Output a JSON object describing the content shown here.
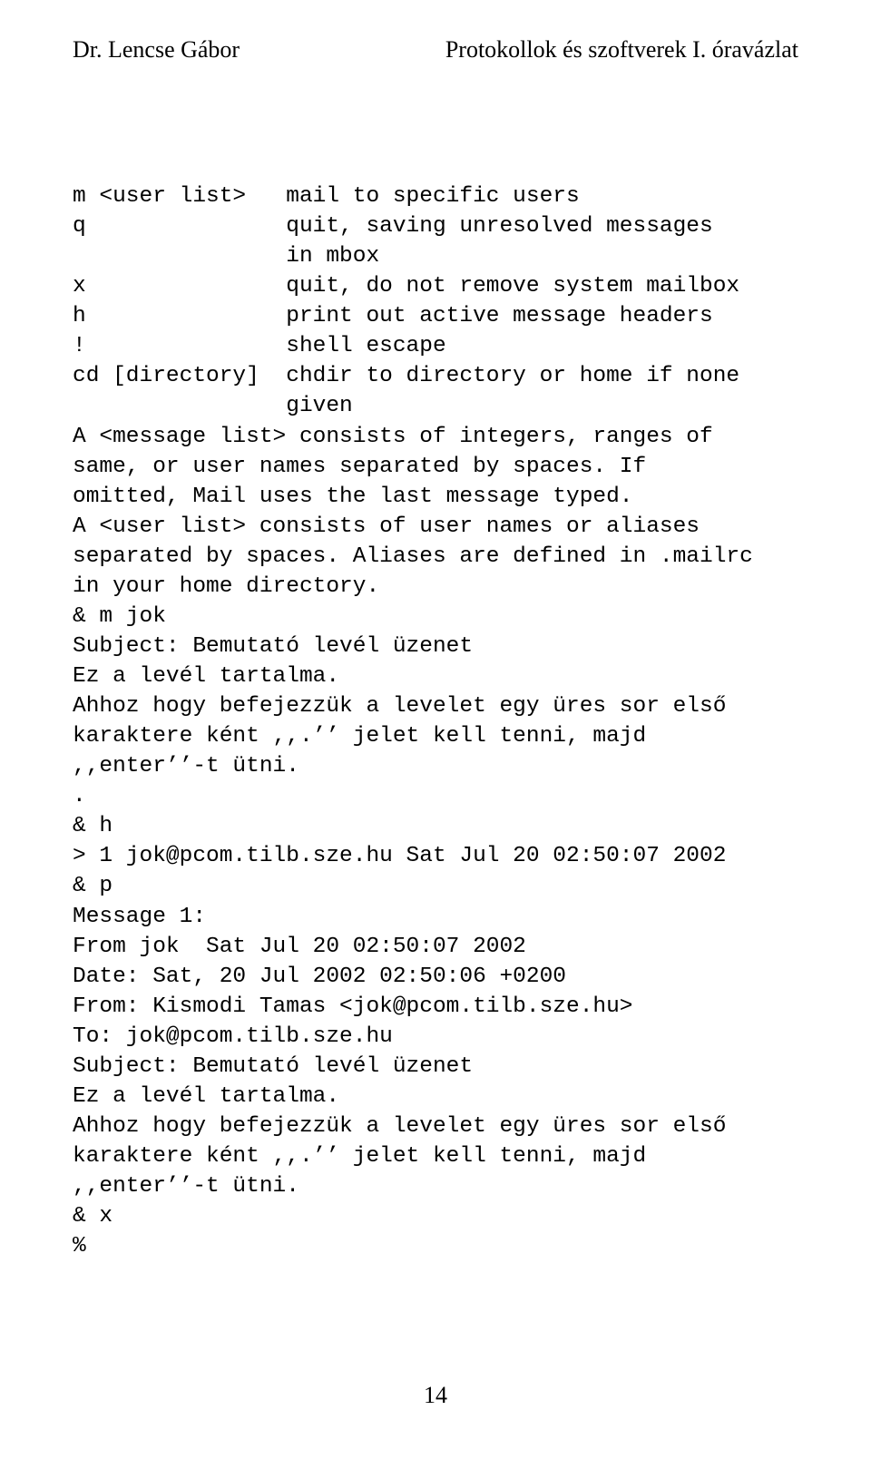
{
  "header": {
    "left": "Dr. Lencse Gábor",
    "right": "Protokollok és szoftverek I. óravázlat"
  },
  "body_text": "m <user list>   mail to specific users\nq               quit, saving unresolved messages\n                in mbox\nx               quit, do not remove system mailbox\nh               print out active message headers\n!               shell escape\ncd [directory]  chdir to directory or home if none\n                given\nA <message list> consists of integers, ranges of\nsame, or user names separated by spaces. If\nomitted, Mail uses the last message typed.\nA <user list> consists of user names or aliases\nseparated by spaces. Aliases are defined in .mailrc\nin your home directory.\n& m jok\nSubject: Bemutató levél üzenet\nEz a levél tartalma.\nAhhoz hogy befejezzük a levelet egy üres sor első\nkaraktere ként ,,.’’ jelet kell tenni, majd\n,,enter’’-t ütni.\n.\n& h\n> 1 jok@pcom.tilb.sze.hu Sat Jul 20 02:50:07 2002\n& p\nMessage 1:\nFrom jok  Sat Jul 20 02:50:07 2002\nDate: Sat, 20 Jul 2002 02:50:06 +0200\nFrom: Kismodi Tamas <jok@pcom.tilb.sze.hu>\nTo: jok@pcom.tilb.sze.hu\nSubject: Bemutató levél üzenet\nEz a levél tartalma.\nAhhoz hogy befejezzük a levelet egy üres sor első\nkaraktere ként ,,.’’ jelet kell tenni, majd\n,,enter’’-t ütni.\n& x\n%",
  "footer": {
    "page_number": "14"
  }
}
